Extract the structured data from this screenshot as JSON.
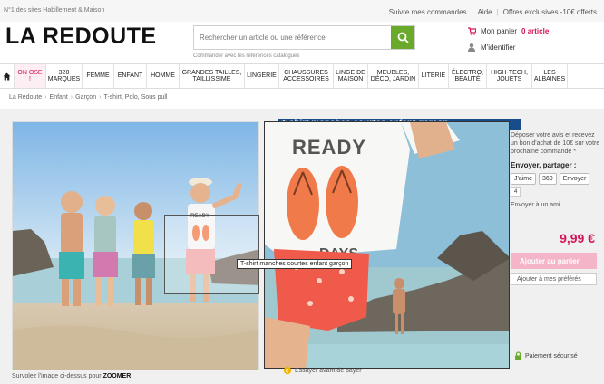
{
  "topbar": {
    "tagline": "N°1 des sites Habillement & Maison",
    "links": [
      "Suivre mes commandes",
      "Aide",
      "Offres exclusives -10€ offerts"
    ]
  },
  "logo": "LA REDOUTE",
  "search": {
    "placeholder": "Rechercher un article ou une référence",
    "hint": "Commander avec les références catalogues"
  },
  "cart": {
    "label": "Mon panier",
    "count": "0 article",
    "account": "M'identifier"
  },
  "nav": {
    "items": [
      {
        "label": "ON OSE !",
        "active": true
      },
      {
        "label": "328 MARQUES",
        "active": false
      },
      {
        "label": "FEMME",
        "active": false
      },
      {
        "label": "ENFANT",
        "active": false
      },
      {
        "label": "HOMME",
        "active": false
      },
      {
        "label": "GRANDES TAILLES, TAILLISSIME",
        "active": false
      },
      {
        "label": "LINGERIE",
        "active": false
      },
      {
        "label": "CHAUSSURES ACCESSOIRES",
        "active": false
      },
      {
        "label": "LINGE DE MAISON",
        "active": false
      },
      {
        "label": "MEUBLES, DÉCO, JARDIN",
        "active": false
      },
      {
        "label": "LITERIE",
        "active": false
      },
      {
        "label": "ÉLECTRO, BEAUTÉ",
        "active": false
      },
      {
        "label": "HIGH-TECH, JOUETS",
        "active": false
      },
      {
        "label": "LES ALBAINES",
        "active": false
      }
    ]
  },
  "breadcrumb": [
    "La Redoute",
    "Enfant",
    "Garçon",
    "T-shirt, Polo, Sous pull"
  ],
  "product": {
    "title": "T-shirt manches courtes enfant garçon",
    "tooltip": "T-shirt manches courtes enfant garçon",
    "zoom_caption_prefix": "Survolez l'image ci-dessus pour",
    "zoom_caption_strong": "ZOOMER",
    "shirt_text_1": "READY",
    "shirt_text_2": "DAYS",
    "avis_text": "Déposer votre avis et recevez un bon d'achat de 10€ sur votre prochaine commande *",
    "share_title": "Envoyer, partager :",
    "share_like": "J'aime",
    "share_360": "360",
    "share_send": "Envoyer",
    "share_count": "4",
    "envoyer_ami": "Envoyer à un ami",
    "price": "9,99 €",
    "add_to_cart": "Ajouter au panier",
    "add_to_favorites": "Ajouter à mes préférés",
    "secure_payment": "Paiement sécurisé",
    "essayer": "Essayer avant de payer"
  },
  "colors": {
    "brand_pink": "#d4145a",
    "search_green": "#6aaa2b",
    "title_blue": "#184d8a"
  }
}
